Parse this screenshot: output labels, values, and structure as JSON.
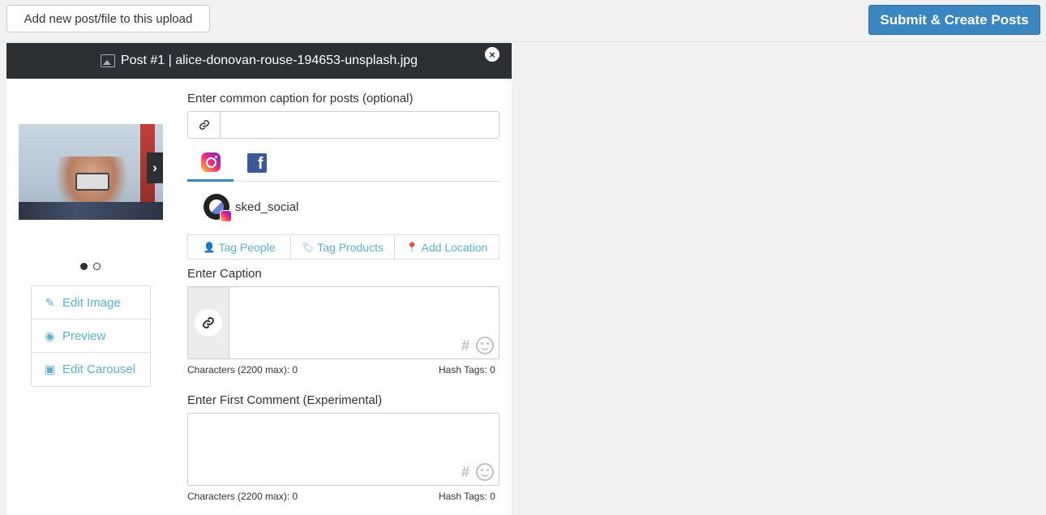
{
  "topbar": {
    "add_label": "Add new post/file to this upload",
    "submit_label": "Submit & Create Posts"
  },
  "post": {
    "title": "Post #1 | alice-donovan-rouse-194653-unsplash.jpg",
    "close_glyph": "×",
    "next_glyph": "›",
    "carousel_dots": [
      {
        "active": true
      },
      {
        "active": false
      }
    ],
    "side_actions": [
      {
        "label": "Edit Image",
        "icon": "pencil-icon",
        "glyph": "✎"
      },
      {
        "label": "Preview",
        "icon": "eye-icon",
        "glyph": "◉"
      },
      {
        "label": "Edit Carousel",
        "icon": "gallery-icon",
        "glyph": "▣"
      }
    ]
  },
  "form": {
    "common_caption_label": "Enter common caption for posts (optional)",
    "common_caption_value": "",
    "tabs": [
      {
        "name": "instagram",
        "icon": "instagram-icon",
        "active": true
      },
      {
        "name": "facebook",
        "icon": "facebook-icon",
        "active": false
      }
    ],
    "facebook_glyph": "f",
    "account_name": "sked_social",
    "tag_buttons": [
      {
        "label": "Tag People",
        "icon": "person-icon",
        "glyph": "👤"
      },
      {
        "label": "Tag Products",
        "icon": "tag-icon",
        "glyph": "🏷"
      },
      {
        "label": "Add Location",
        "icon": "location-pin-icon",
        "glyph": "📍"
      }
    ],
    "caption_label": "Enter Caption",
    "caption_value": "",
    "caption_chars": "Characters (2200 max): 0",
    "caption_hashtags": "Hash Tags: 0",
    "comment_label": "Enter First Comment (Experimental)",
    "comment_value": "",
    "comment_chars": "Characters (2200 max): 0",
    "comment_hashtags": "Hash Tags: 0",
    "hash_glyph": "#"
  },
  "colors": {
    "primary": "#3a86c0",
    "link": "#5bb0d8",
    "header_bg": "#2c3035"
  }
}
